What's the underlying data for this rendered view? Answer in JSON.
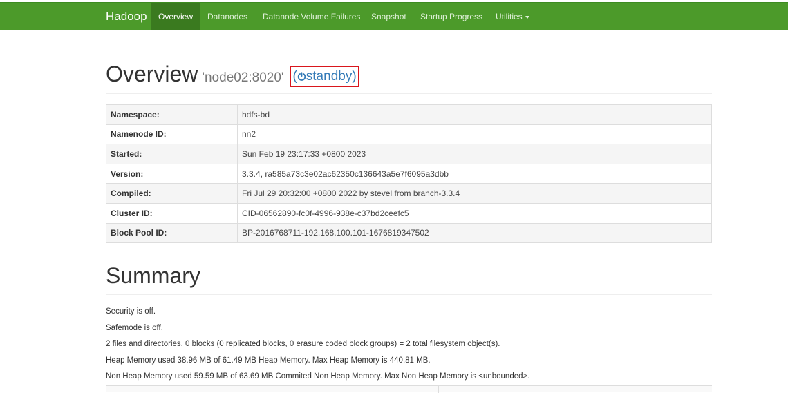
{
  "navbar": {
    "brand": "Hadoop",
    "items": [
      {
        "label": "Overview",
        "active": true
      },
      {
        "label": "Datanodes"
      },
      {
        "label": "Datanode Volume Failures"
      },
      {
        "label": "Snapshot"
      },
      {
        "label": "Startup Progress"
      },
      {
        "label": "Utilities"
      }
    ],
    "color": "#4c9a2a"
  },
  "overview": {
    "title": "Overview",
    "address": "'node02:8020'",
    "state_open": "(",
    "state_label": "standby",
    "state_close": ")",
    "state_icon": "power-icon",
    "highlight_color": "#d9161d"
  },
  "info_table": [
    {
      "key": "Namespace:",
      "value": "hdfs-bd"
    },
    {
      "key": "Namenode ID:",
      "value": "nn2"
    },
    {
      "key": "Started:",
      "value": "Sun Feb 19 23:17:33 +0800 2023"
    },
    {
      "key": "Version:",
      "value": "3.3.4, ra585a73c3e02ac62350c136643a5e7f6095a3dbb"
    },
    {
      "key": "Compiled:",
      "value": "Fri Jul 29 20:32:00 +0800 2022 by stevel from branch-3.3.4"
    },
    {
      "key": "Cluster ID:",
      "value": "CID-06562890-fc0f-4996-938e-c37bd2ceefc5"
    },
    {
      "key": "Block Pool ID:",
      "value": "BP-2016768711-192.168.100.101-1676819347502"
    }
  ],
  "summary": {
    "title": "Summary",
    "lines": [
      "Security is off.",
      "Safemode is off.",
      "2 files and directories, 0 blocks (0 replicated blocks, 0 erasure coded block groups) = 2 total filesystem object(s).",
      "Heap Memory used 38.96 MB of 61.49 MB Heap Memory. Max Heap Memory is 440.81 MB.",
      "Non Heap Memory used 59.59 MB of 63.69 MB Commited Non Heap Memory. Max Non Heap Memory is <unbounded>."
    ]
  }
}
